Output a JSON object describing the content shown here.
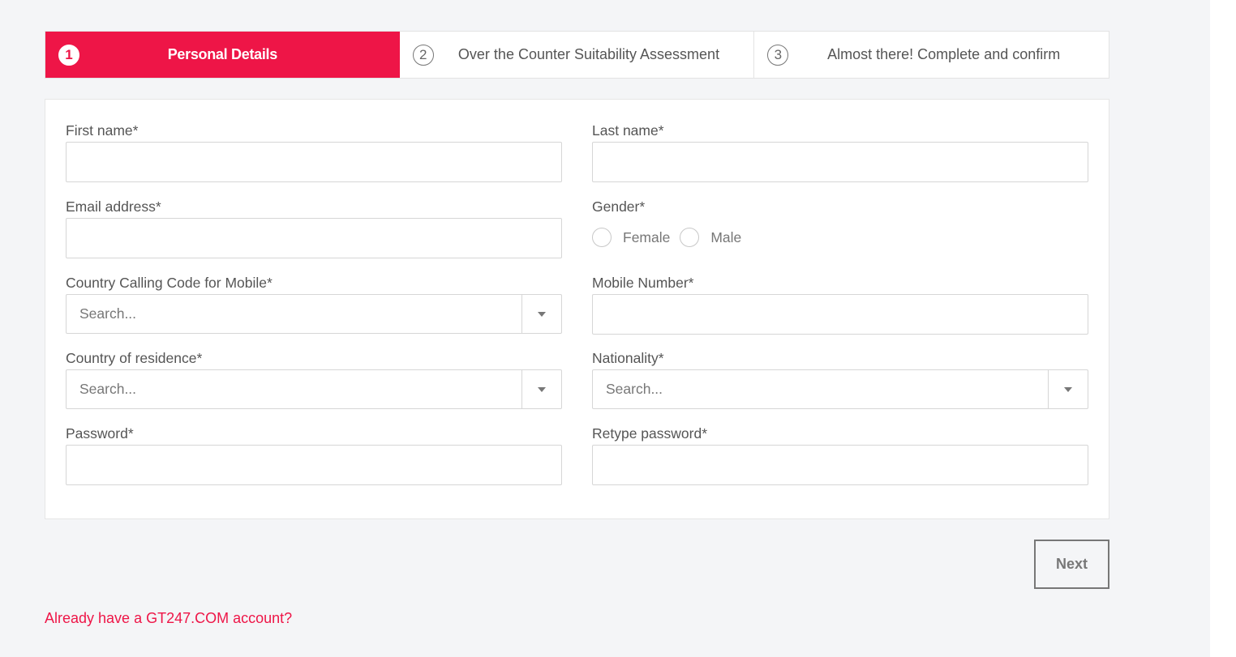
{
  "steps": [
    {
      "number": "1",
      "label": "Personal Details",
      "active": true
    },
    {
      "number": "2",
      "label": "Over the Counter Suitability Assessment",
      "active": false
    },
    {
      "number": "3",
      "label": "Almost there! Complete and confirm",
      "active": false
    }
  ],
  "form": {
    "first_name": {
      "label": "First name*",
      "value": ""
    },
    "last_name": {
      "label": "Last name*",
      "value": ""
    },
    "email": {
      "label": "Email address*",
      "value": ""
    },
    "gender": {
      "label": "Gender*",
      "options": [
        "Female",
        "Male"
      ],
      "selected": null
    },
    "calling_code": {
      "label": "Country Calling Code for Mobile*",
      "placeholder": "Search..."
    },
    "mobile": {
      "label": "Mobile Number*",
      "value": ""
    },
    "residence": {
      "label": "Country of residence*",
      "placeholder": "Search..."
    },
    "nationality": {
      "label": "Nationality*",
      "placeholder": "Search..."
    },
    "password": {
      "label": "Password*",
      "value": ""
    },
    "retype_password": {
      "label": "Retype password*",
      "value": ""
    }
  },
  "actions": {
    "next_label": "Next",
    "login_link": "Already have a GT247.COM account?"
  },
  "colors": {
    "accent": "#ee1547",
    "background": "#f4f5f7"
  }
}
